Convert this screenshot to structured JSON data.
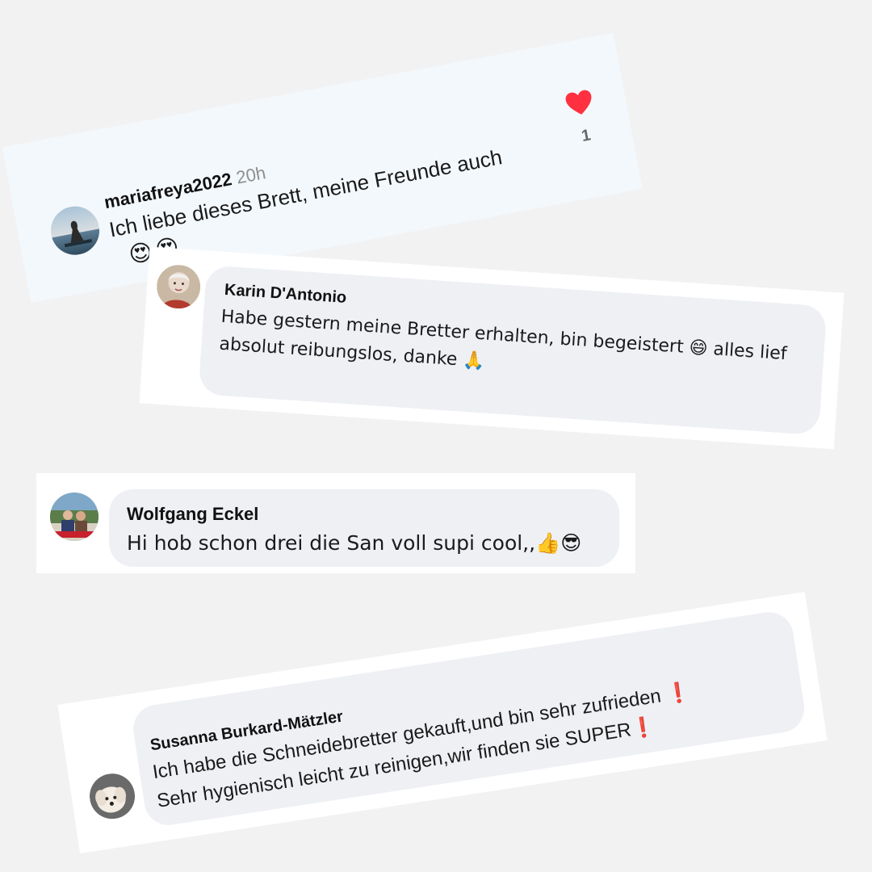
{
  "comments": [
    {
      "username": "mariafreya2022",
      "time": "20h",
      "line1": "Ich liebe dieses Brett,  meine Freunde auch",
      "line2": "😍😍",
      "likes": "1",
      "heart_color": "#ff3040",
      "icon": "heart-icon"
    },
    {
      "username": "Karin D'Antonio",
      "line1": "Habe gestern meine Bretter erhalten, bin begeistert 😄 alles lief",
      "line2": "absolut reibungslos, danke 🙏"
    },
    {
      "username": "Wolfgang Eckel",
      "line1": "Hi hob schon drei die San voll supi cool,,👍😎"
    },
    {
      "username": "Susanna Burkard-Mätzler",
      "line1_text": "Ich habe die Schneidebretter gekauft,und bin sehr zufrieden ",
      "line1_mark": "❗",
      "line2_text": "Sehr hygienisch leicht zu reinigen,wir finden sie SUPER",
      "line2_mark": "❗"
    }
  ],
  "colors": {
    "background": "#f2f2f2",
    "bubble": "#eef0f4",
    "instagram_card": "#f3f8fc",
    "accent_red": "#e0201c"
  }
}
